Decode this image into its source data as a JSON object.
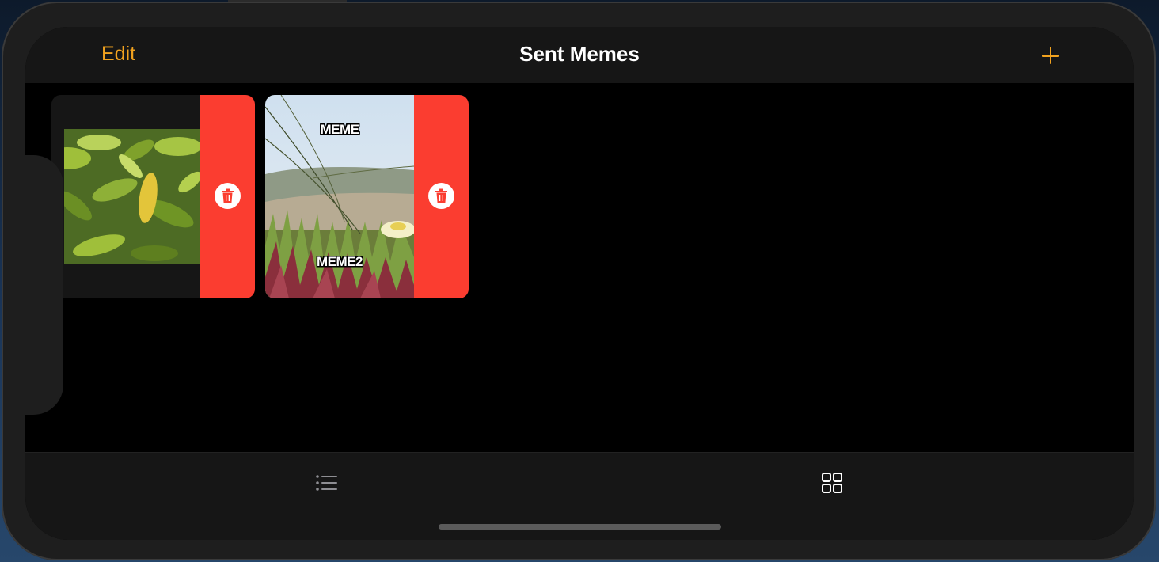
{
  "navbar": {
    "edit_label": "Edit",
    "title": "Sent Memes",
    "add_icon": "plus-icon"
  },
  "memes": [
    {
      "top_text": "",
      "bottom_text": "",
      "image": "leaves-photo",
      "action_icon": "trash-icon"
    },
    {
      "top_text": "MEME",
      "bottom_text": "MEME2",
      "image": "dune-flower-photo",
      "action_icon": "trash-icon"
    }
  ],
  "tabbar": {
    "items": [
      {
        "icon": "list-icon"
      },
      {
        "icon": "grid-icon"
      }
    ]
  },
  "colors": {
    "accent": "#f1a21f",
    "delete": "#fb3d30",
    "bar_background": "#161616",
    "content_background": "#000000"
  }
}
